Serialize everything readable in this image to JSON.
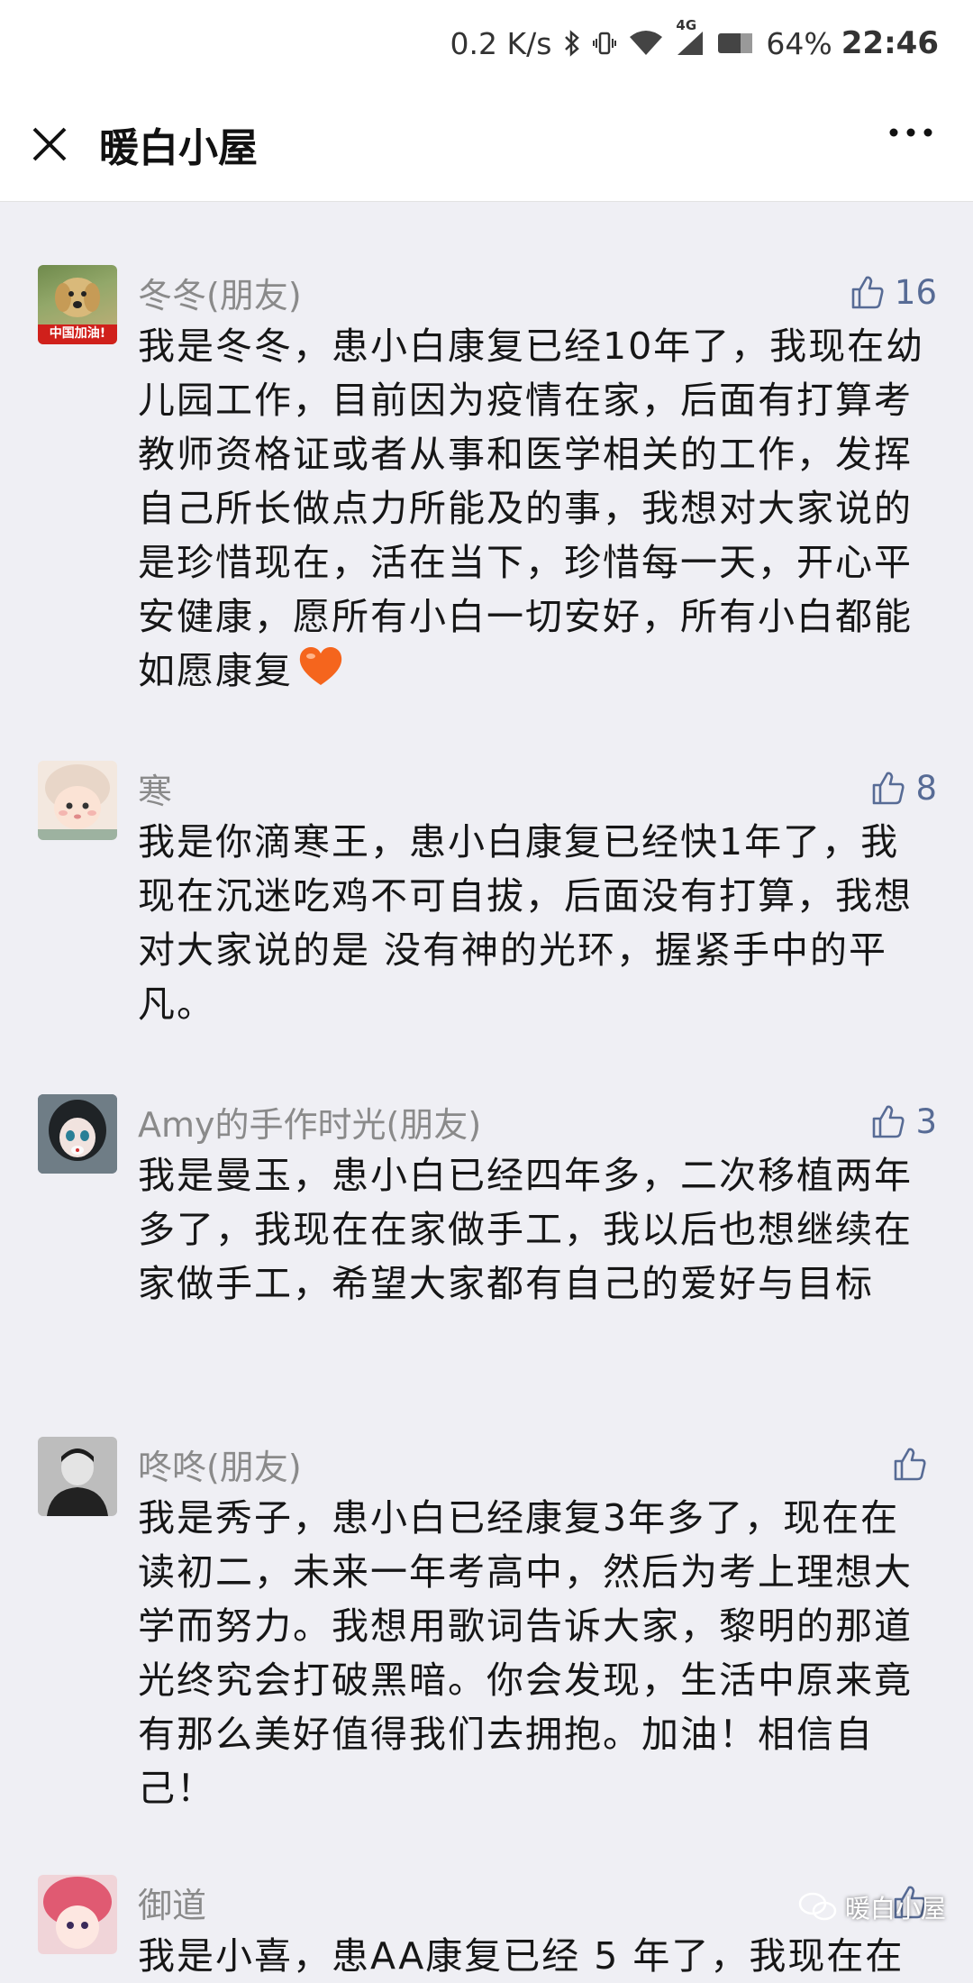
{
  "status_bar": {
    "net_speed": "0.2 K/s",
    "network": "4G",
    "battery": "64%",
    "time": "22:46"
  },
  "nav": {
    "title": "暖白小屋",
    "close_icon": "close-icon",
    "more_icon": "more-icon"
  },
  "comments": [
    {
      "name": "冬冬(朋友)",
      "likes": "16",
      "text": "我是冬冬，患小白康复已经10年了，我现在幼儿园工作，目前因为疫情在家，后面有打算考教师资格证或者从事和医学相关的工作，发挥自己所长做点力所能及的事，我想对大家说的是珍惜现在，活在当下，珍惜每一天，开心平安健康，愿所有小白一切安好，所有小白都能如愿康复",
      "avatar_caption": "中国加油!"
    },
    {
      "name": "寒",
      "likes": "8",
      "text": "我是你滴寒王，患小白康复已经快1年了，我现在沉迷吃鸡不可自拔，后面没有打算，我想对大家说的是 没有神的光环，握紧手中的平凡。"
    },
    {
      "name": "Amy的手作时光(朋友)",
      "likes": "3",
      "text": "我是曼玉，患小白已经四年多，二次移植两年多了，我现在在家做手工，我以后也想继续在家做手工，希望大家都有自己的爱好与目标"
    },
    {
      "name": "咚咚(朋友)",
      "likes": "",
      "text": "我是秀子，患小白已经康复3年多了，现在在读初二，未来一年考高中，然后为考上理想大学而努力。我想用歌词告诉大家，黎明的那道光终究会打破黑暗。你会发现，生活中原来竟有那么美好值得我们去拥抱。加油！相信自己！"
    },
    {
      "name": "御道",
      "likes": "",
      "text": "我是小喜，患AA康复已经 5 年了，我现在在"
    }
  ],
  "watermark": {
    "text": "暖白小屋"
  },
  "colors": {
    "link_blue": "#576b95",
    "name_gray": "#8a8a8a",
    "heart": "#f5651d"
  }
}
